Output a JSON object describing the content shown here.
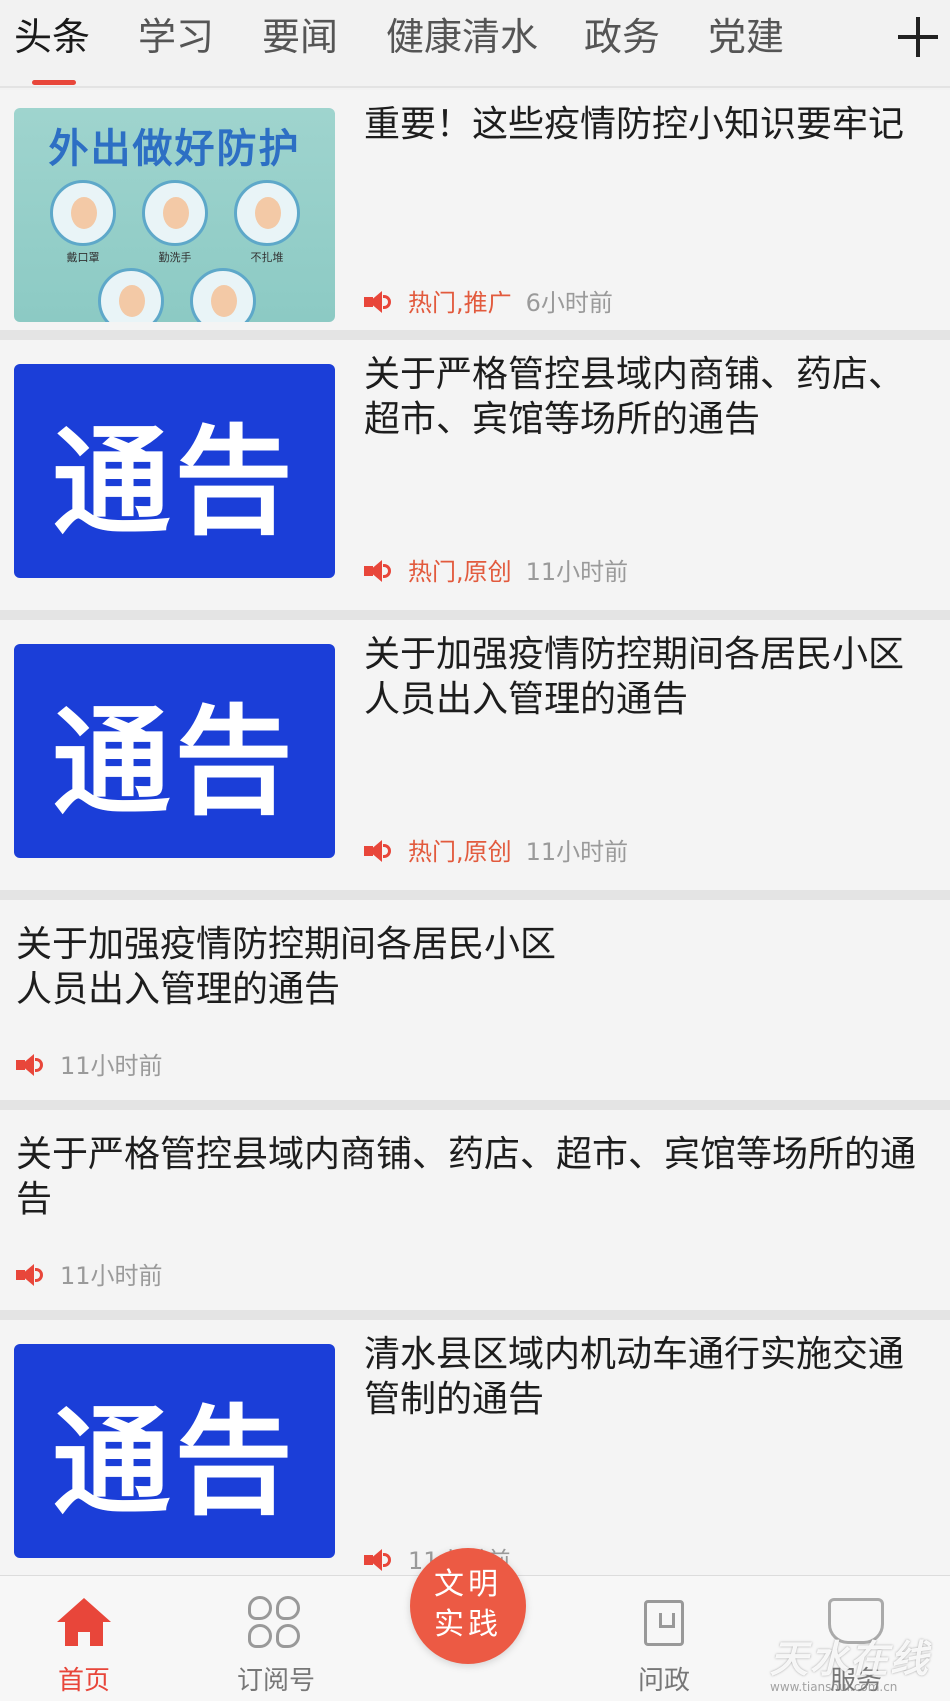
{
  "tabs": [
    {
      "label": "头条",
      "active": true
    },
    {
      "label": "学习",
      "active": false
    },
    {
      "label": "要闻",
      "active": false
    },
    {
      "label": "健康清水",
      "active": false
    },
    {
      "label": "政务",
      "active": false
    },
    {
      "label": "党建",
      "active": false
    }
  ],
  "accent_color": "#e8463a",
  "articles": [
    {
      "title": "重要！这些疫情防控小知识要牢记",
      "thumbnail": "poster",
      "poster": {
        "title": "外出做好防护",
        "captions": [
          "戴口罩",
          "勤洗手",
          "不扎堆"
        ]
      },
      "tags": "热门,推广",
      "time": "6小时前"
    },
    {
      "title": "关于严格管控县域内商铺、药店、超市、宾馆等场所的通告",
      "thumbnail": "notice",
      "thumbnail_text": "通告",
      "tags": "热门,原创",
      "time": "11小时前"
    },
    {
      "title": "关于加强疫情防控期间各居民小区人员出入管理的通告",
      "thumbnail": "notice",
      "thumbnail_text": "通告",
      "tags": "热门,原创",
      "time": "11小时前"
    },
    {
      "title": "关于加强疫情防控期间各居民小区\n人员出入管理的通告",
      "thumbnail": "none",
      "time": "11小时前"
    },
    {
      "title": "关于严格管控县域内商铺、药店、超市、宾馆等场所的通告",
      "thumbnail": "none",
      "time": "11小时前"
    },
    {
      "title": "清水县区域内机动车通行实施交通管制的通告",
      "thumbnail": "notice",
      "thumbnail_text": "通告",
      "time": "11小时前"
    }
  ],
  "bottom_nav": {
    "home": "首页",
    "subscriptions": "订阅号",
    "center_line1": "文明",
    "center_line2": "实践",
    "inquiry": "问政",
    "service": "服务"
  },
  "watermark": {
    "text": "天水在线",
    "url": "www.tianshui.com.cn"
  }
}
